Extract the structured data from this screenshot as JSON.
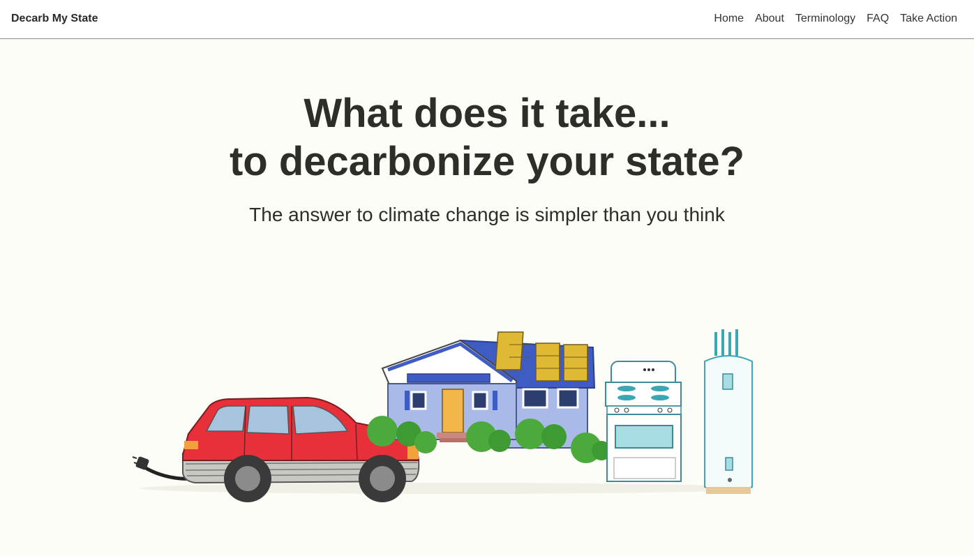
{
  "navbar": {
    "brand": "Decarb My State",
    "links": [
      "Home",
      "About",
      "Terminology",
      "FAQ",
      "Take Action"
    ]
  },
  "hero": {
    "title_line1": "What does it take...",
    "title_line2": "to decarbonize your state?",
    "subtitle": "The answer to climate change is simpler than you think"
  },
  "colors": {
    "background": "#fdfdf8",
    "text": "#2d2d2a",
    "car": "#e8303a",
    "house": "#a9b9e8",
    "roof": "#3f5bc4",
    "solar": "#e0b934",
    "appliance_accent": "#3aa7b5"
  },
  "illustration": {
    "items": [
      "electric-car-icon",
      "house-with-solar-icon",
      "electric-stove-icon",
      "heat-pump-water-heater-icon"
    ]
  }
}
